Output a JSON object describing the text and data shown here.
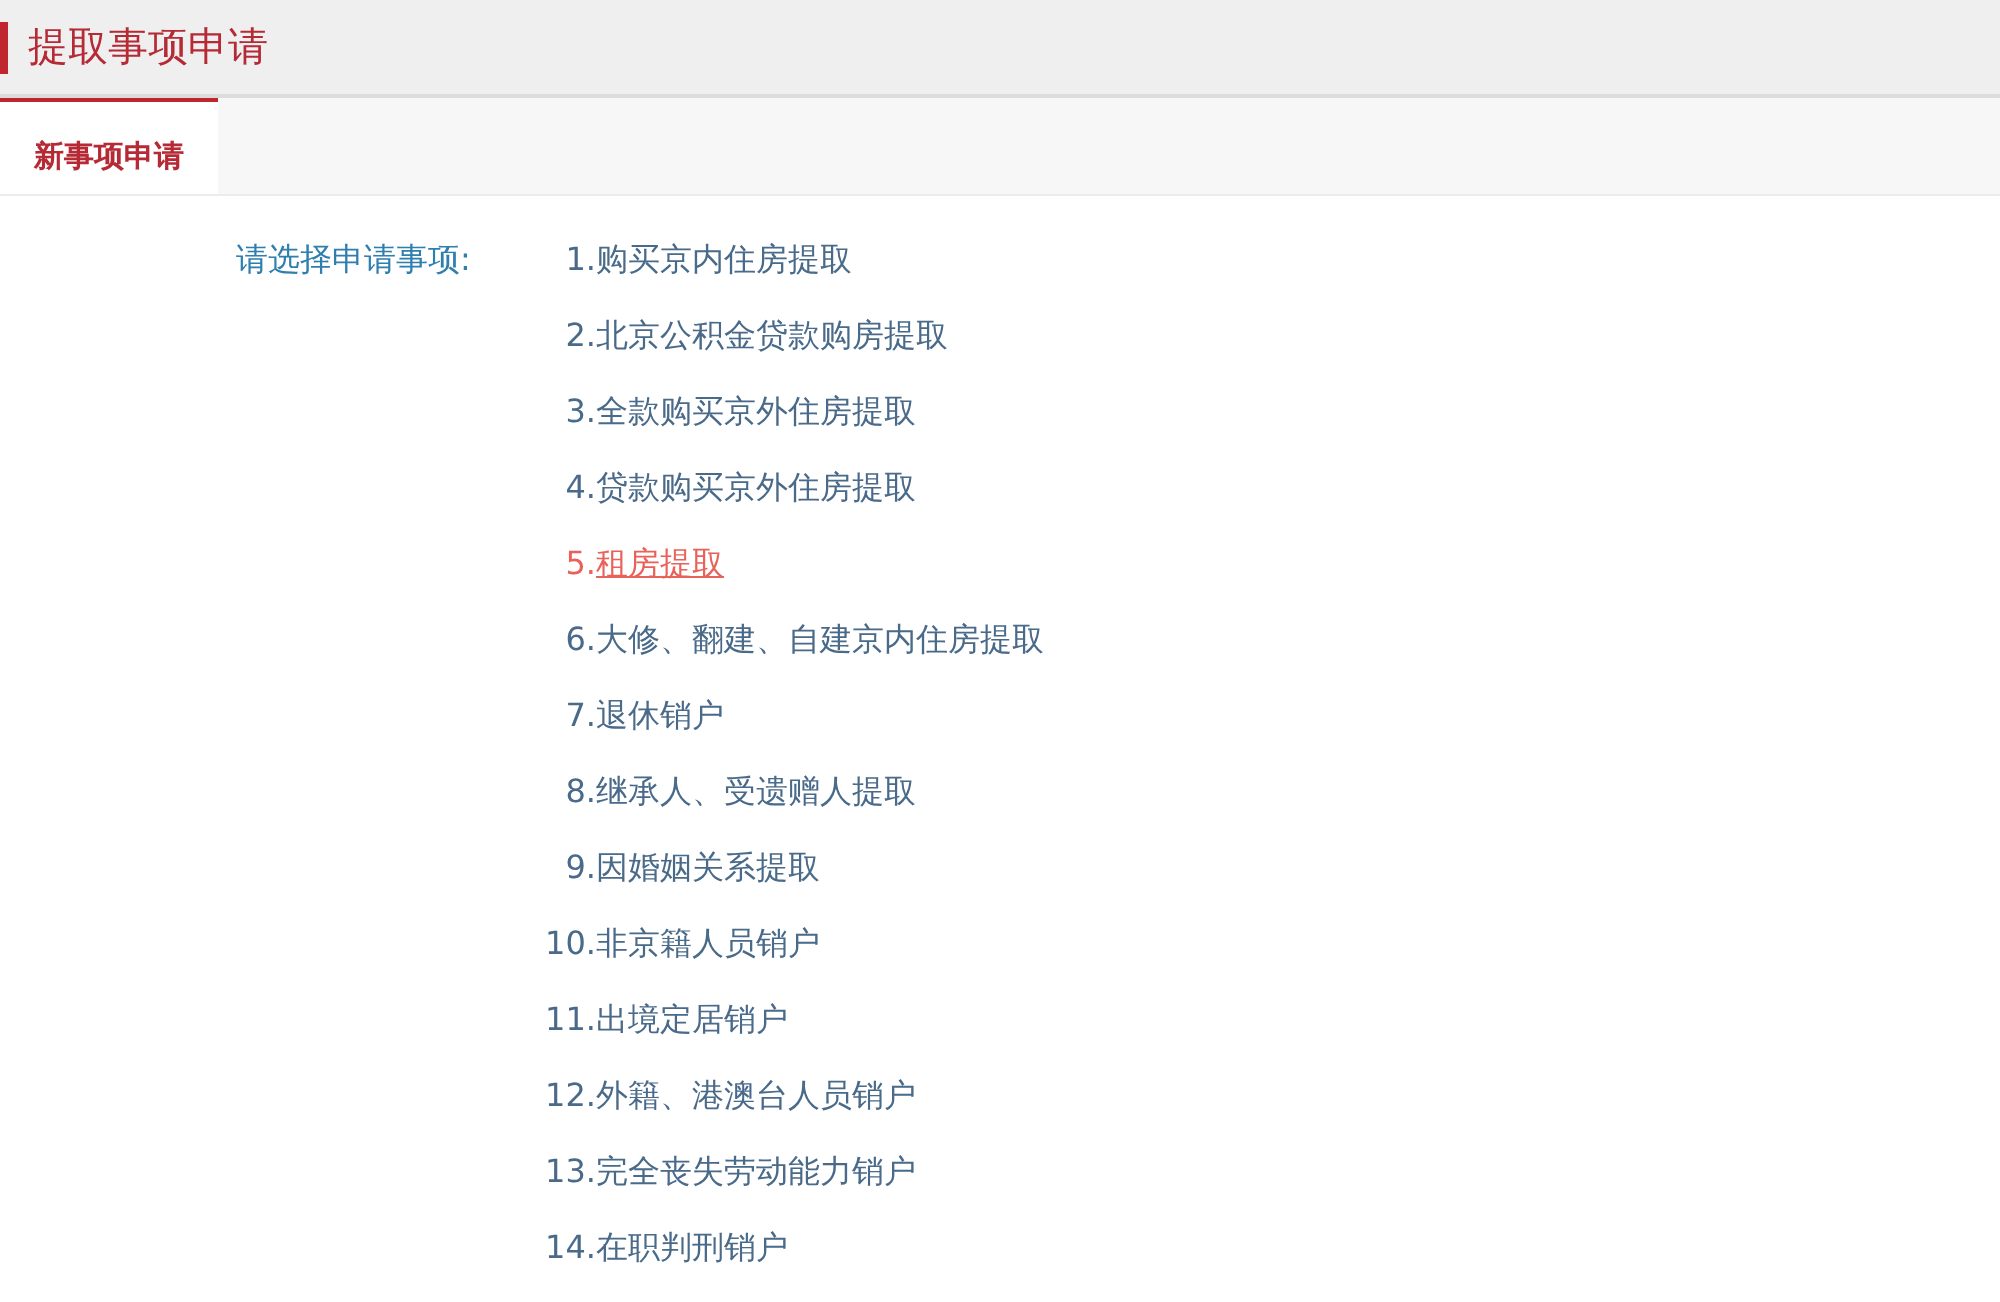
{
  "header": {
    "title": "提取事项申请"
  },
  "tabs": [
    {
      "label": "新事项申请",
      "selected": true
    }
  ],
  "form": {
    "label": "请选择申请事项:",
    "items": [
      {
        "number": "1.",
        "label": "购买京内住房提取",
        "selected": false
      },
      {
        "number": "2.",
        "label": "北京公积金贷款购房提取",
        "selected": false
      },
      {
        "number": "3.",
        "label": "全款购买京外住房提取",
        "selected": false
      },
      {
        "number": "4.",
        "label": "贷款购买京外住房提取",
        "selected": false
      },
      {
        "number": "5.",
        "label": "租房提取",
        "selected": true
      },
      {
        "number": "6.",
        "label": "大修、翻建、自建京内住房提取",
        "selected": false
      },
      {
        "number": "7.",
        "label": "退休销户",
        "selected": false
      },
      {
        "number": "8.",
        "label": "继承人、受遗赠人提取",
        "selected": false
      },
      {
        "number": "9.",
        "label": "因婚姻关系提取",
        "selected": false
      },
      {
        "number": "10.",
        "label": "非京籍人员销户",
        "selected": false
      },
      {
        "number": "11.",
        "label": "出境定居销户",
        "selected": false
      },
      {
        "number": "12.",
        "label": "外籍、港澳台人员销户",
        "selected": false
      },
      {
        "number": "13.",
        "label": "完全丧失劳动能力销户",
        "selected": false
      },
      {
        "number": "14.",
        "label": "在职判刑销户",
        "selected": false
      }
    ]
  }
}
